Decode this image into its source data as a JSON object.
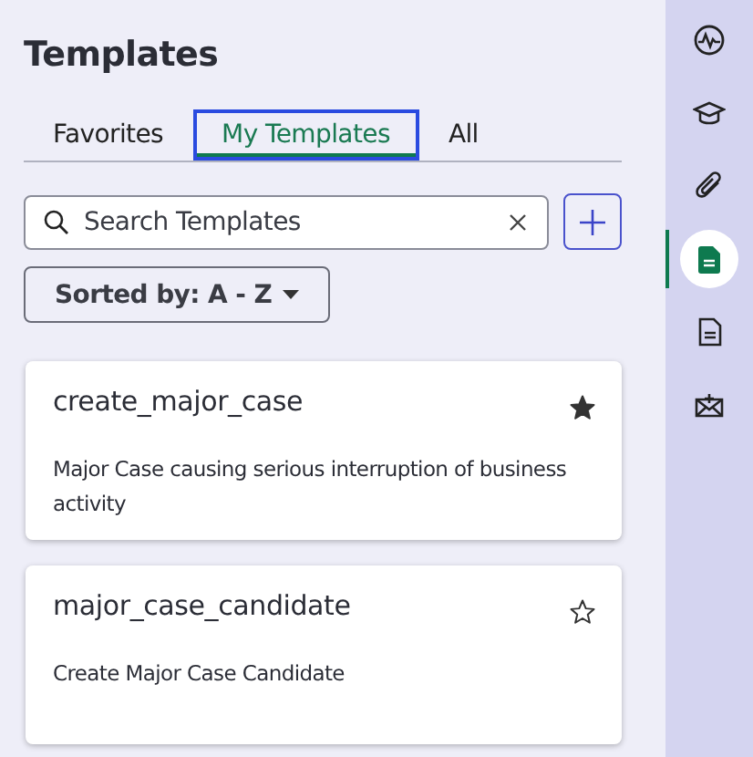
{
  "title": "Templates",
  "tabs": [
    {
      "label": "Favorites",
      "selected": false
    },
    {
      "label": "My Templates",
      "selected": true
    },
    {
      "label": "All",
      "selected": false
    }
  ],
  "search": {
    "placeholder": "Search Templates"
  },
  "sort": {
    "label": "Sorted by: A - Z"
  },
  "templates": [
    {
      "name": "create_major_case",
      "description": "Major Case causing serious interruption of business activity",
      "favorite": true
    },
    {
      "name": "major_case_candidate",
      "description": "Create Major Case Candidate",
      "favorite": false
    }
  ],
  "rail": [
    {
      "kind": "activity",
      "selected": false
    },
    {
      "kind": "learning",
      "selected": false
    },
    {
      "kind": "attachment",
      "selected": false
    },
    {
      "kind": "template",
      "selected": true
    },
    {
      "kind": "document",
      "selected": false
    },
    {
      "kind": "email",
      "selected": false
    }
  ]
}
